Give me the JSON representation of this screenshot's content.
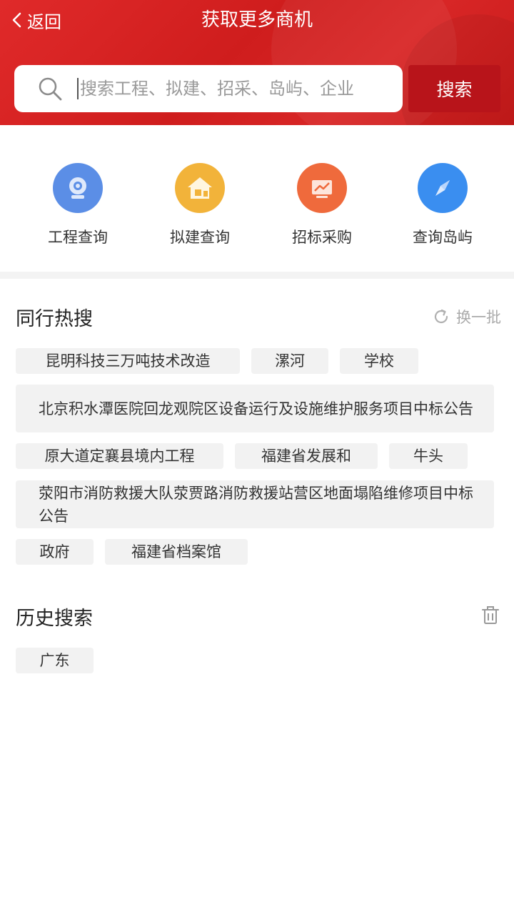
{
  "header": {
    "back_label": "返回",
    "title": "获取更多商机",
    "search_placeholder": "搜索工程、拟建、招采、岛屿、企业",
    "search_button": "搜索",
    "accent_color": "#d42222"
  },
  "quick_actions": [
    {
      "label": "工程查询",
      "icon": "camera-icon",
      "color": "#5b8ee6"
    },
    {
      "label": "拟建查询",
      "icon": "house-icon",
      "color": "#f2b33a"
    },
    {
      "label": "招标采购",
      "icon": "chart-board-icon",
      "color": "#ef6a3c"
    },
    {
      "label": "查询岛屿",
      "icon": "compass-icon",
      "color": "#3a8ef0"
    }
  ],
  "hot_search": {
    "title": "同行热搜",
    "refresh_label": "换一批",
    "tags": [
      "昆明科技三万吨技术改造",
      "漯河",
      "学校",
      "北京积水潭医院回龙观院区设备运行及设施维护服务项目中标公告",
      "原大道定襄县境内工程",
      "福建省发展和",
      "牛头",
      "荥阳市消防救援大队荥贾路消防救援站营区地面塌陷维修项目中标公告",
      "政府",
      "福建省档案馆"
    ]
  },
  "history": {
    "title": "历史搜索",
    "tags": [
      "广东"
    ]
  }
}
